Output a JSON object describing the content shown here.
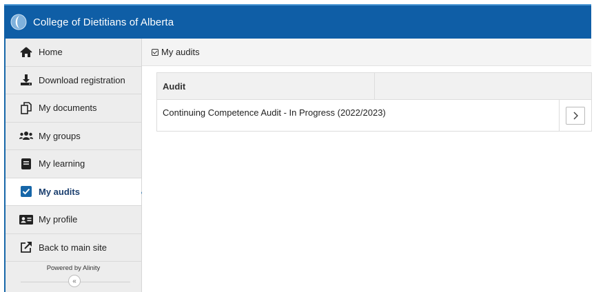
{
  "header": {
    "title": "College of Dietitians of Alberta"
  },
  "sidebar": {
    "items": [
      {
        "label": "Home",
        "icon": "home-icon"
      },
      {
        "label": "Download registration",
        "icon": "download-icon"
      },
      {
        "label": "My documents",
        "icon": "documents-icon"
      },
      {
        "label": "My groups",
        "icon": "groups-icon"
      },
      {
        "label": "My learning",
        "icon": "book-icon"
      },
      {
        "label": "My audits",
        "icon": "checkbox-icon",
        "active": true
      },
      {
        "label": "My profile",
        "icon": "profile-card-icon"
      },
      {
        "label": "Back to main site",
        "icon": "external-link-icon"
      }
    ],
    "powered_by": "Powered by Alinity",
    "collapse_glyph": "«"
  },
  "breadcrumb": {
    "label": "My audits"
  },
  "table": {
    "columns": [
      "Audit",
      ""
    ],
    "rows": [
      {
        "audit": "Continuing Competence Audit - In Progress (2022/2023)",
        "action_glyph": "›"
      }
    ]
  },
  "colors": {
    "header_bg": "#0f5ea6",
    "accent": "#1666a8",
    "sidebar_bg": "#ededed"
  }
}
